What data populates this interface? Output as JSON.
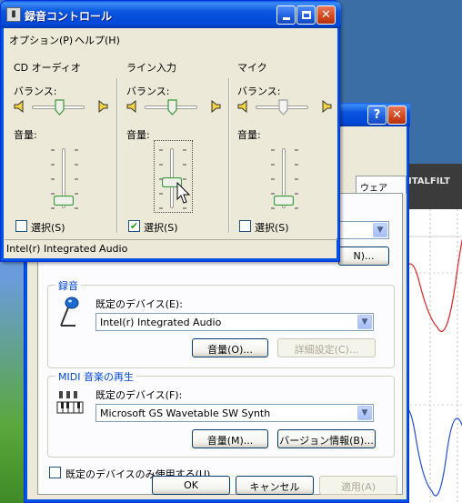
{
  "volume_control": {
    "title": "録音コントロール",
    "menu": [
      "オプション(P)",
      "ヘルプ(H)"
    ],
    "balance_label": "バランス:",
    "volume_label": "音量:",
    "select_label": "選択(S)",
    "columns": [
      {
        "title": "CD オーディオ",
        "selected": false,
        "volume_level": 0.1,
        "balance": 0.5
      },
      {
        "title": "ライン入力",
        "selected": true,
        "volume_level": 0.45,
        "balance": 0.5
      },
      {
        "title": "マイク",
        "selected": false,
        "volume_level": 0.1,
        "balance": 0.5
      }
    ],
    "status": "Intel(r) Integrated Audio"
  },
  "properties_dialog": {
    "tab_label_partial": "ウェア",
    "advanced_button_partial": "N)...",
    "recording": {
      "group_label": "録音",
      "default_device_label": "既定のデバイス(E):",
      "device_value": "Intel(r) Integrated Audio",
      "volume_button": "音量(O)...",
      "advanced_button": "詳細設定(C)..."
    },
    "midi": {
      "group_label": "MIDI 音楽の再生",
      "default_device_label": "既定のデバイス(F):",
      "device_value": "Microsoft GS Wavetable SW Synth",
      "volume_button": "音量(M)...",
      "about_button": "バージョン情報(B)..."
    },
    "use_default_only_label": "既定のデバイスのみ使用する(U)",
    "use_default_only_checked": false,
    "ok_button": "OK",
    "cancel_button": "キャンセル",
    "apply_button": "適用(A)"
  },
  "background_app": {
    "header_partial": "ITALFILT"
  },
  "colors": {
    "titlebar_blue": "#0054e3",
    "dialog_bg": "#ece9d8",
    "group_label_blue": "#0046d5",
    "wave_red": "#e02020",
    "wave_blue": "#2050e0"
  }
}
